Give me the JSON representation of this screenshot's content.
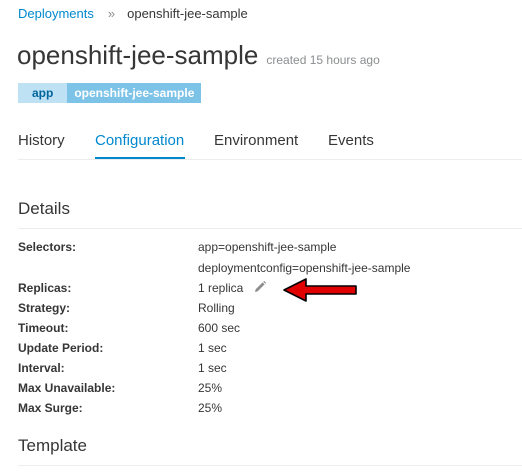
{
  "breadcrumb": {
    "parent": "Deployments",
    "separator": "»",
    "current": "openshift-jee-sample"
  },
  "header": {
    "title": "openshift-jee-sample",
    "meta": "created 15 hours ago"
  },
  "labels": [
    {
      "key": "app",
      "value": "openshift-jee-sample"
    }
  ],
  "tabs": [
    {
      "label": "History",
      "active": false
    },
    {
      "label": "Configuration",
      "active": true
    },
    {
      "label": "Environment",
      "active": false
    },
    {
      "label": "Events",
      "active": false
    }
  ],
  "details": {
    "heading": "Details",
    "rows": [
      {
        "key": "Selectors:",
        "values": [
          "app=openshift-jee-sample",
          "deploymentconfig=openshift-jee-sample"
        ]
      },
      {
        "key": "Replicas:",
        "values": [
          "1 replica"
        ]
      },
      {
        "key": "Strategy:",
        "values": [
          "Rolling"
        ]
      },
      {
        "key": "Timeout:",
        "values": [
          "600 sec"
        ]
      },
      {
        "key": "Update Period:",
        "values": [
          "1 sec"
        ]
      },
      {
        "key": "Interval:",
        "values": [
          "1 sec"
        ]
      },
      {
        "key": "Max Unavailable:",
        "values": [
          "25%"
        ]
      },
      {
        "key": "Max Surge:",
        "values": [
          "25%"
        ]
      }
    ]
  },
  "template": {
    "heading": "Template"
  },
  "icons": {
    "edit_replicas": "pencil-icon",
    "annotation": "red-arrow-left-icon"
  },
  "colors": {
    "link": "#0088ce",
    "label_key_bg": "#bee1f4",
    "label_value_bg": "#7dc3e8",
    "annotation_arrow": "#e00000"
  }
}
